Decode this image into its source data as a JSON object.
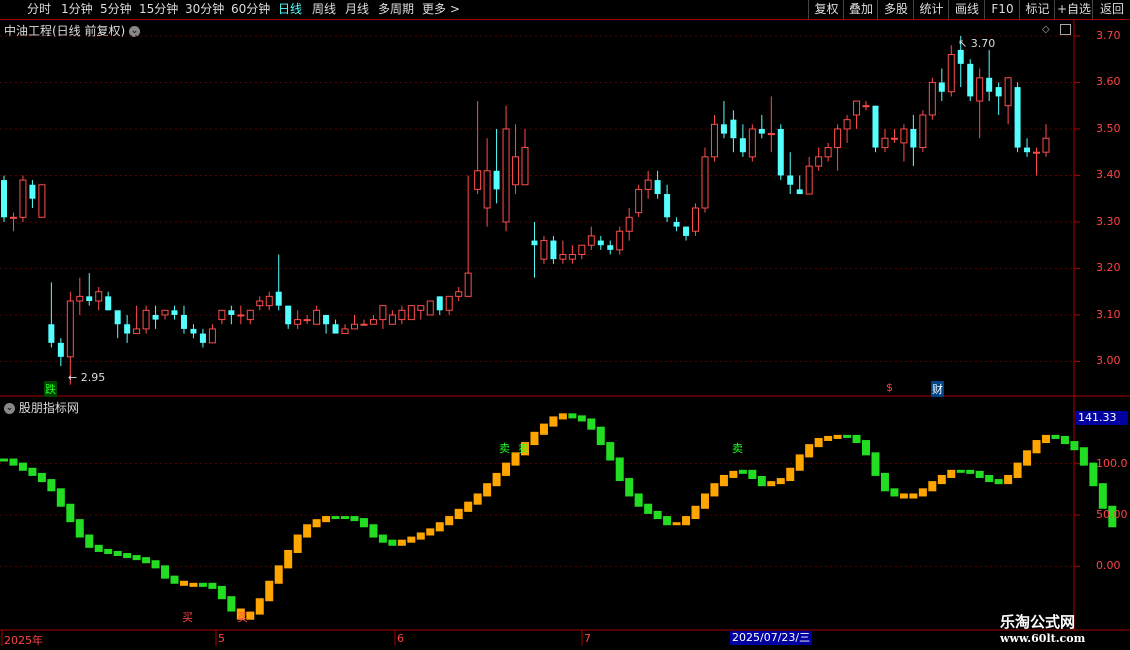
{
  "toolbar": {
    "periods": [
      "分时",
      "1分钟",
      "5分钟",
      "15分钟",
      "30分钟",
      "60分钟",
      "日线",
      "周线",
      "月线",
      "多周期",
      "更多 >"
    ],
    "active": "日线",
    "right_buttons": [
      "复权",
      "叠加",
      "多股",
      "统计",
      "画线",
      "F10",
      "标记",
      "+自选",
      "返回"
    ]
  },
  "chart_title": "中油工程(日线 前复权)",
  "indicator_title": "股朋指标网",
  "price_axis": [
    "3.70",
    "3.60",
    "3.50",
    "3.40",
    "3.30",
    "3.20",
    "3.10",
    "3.00"
  ],
  "indicator_axis": [
    "100.0",
    "50.00",
    "0.00"
  ],
  "indicator_value": "141.33",
  "x_labels": [
    "2025年",
    "5",
    "6",
    "7"
  ],
  "date_cursor": "2025/07/23/三",
  "annotations": {
    "high": "3.70",
    "low": "2.95",
    "low_marker": "跌",
    "cai_marker": "财",
    "dollar_marker": "$",
    "buy": "买",
    "sell": "卖"
  },
  "watermark": {
    "line1": "乐淘公式网",
    "line2": "www.60lt.com"
  },
  "colors": {
    "up": "#ff4d4d",
    "down": "#54ffff",
    "ind_up": "#ffa500",
    "ind_down": "#22dd22",
    "grid": "#a00000"
  },
  "chart_data": {
    "type": "candlestick",
    "ylim": [
      2.93,
      3.73
    ],
    "candles": [
      [
        3.39,
        3.31,
        3.4,
        3.3
      ],
      [
        3.31,
        3.31,
        3.32,
        3.28
      ],
      [
        3.31,
        3.39,
        3.4,
        3.3
      ],
      [
        3.38,
        3.35,
        3.39,
        3.33
      ],
      [
        3.31,
        3.38,
        3.38,
        3.31
      ],
      [
        3.08,
        3.04,
        3.17,
        3.03
      ],
      [
        3.04,
        3.01,
        3.05,
        2.99
      ],
      [
        3.01,
        3.13,
        3.15,
        2.95
      ],
      [
        3.13,
        3.14,
        3.18,
        3.1
      ],
      [
        3.14,
        3.13,
        3.19,
        3.12
      ],
      [
        3.13,
        3.15,
        3.16,
        3.11
      ],
      [
        3.14,
        3.11,
        3.15,
        3.11
      ],
      [
        3.11,
        3.08,
        3.1,
        3.05
      ],
      [
        3.08,
        3.06,
        3.1,
        3.04
      ],
      [
        3.06,
        3.07,
        3.12,
        3.06
      ],
      [
        3.07,
        3.11,
        3.12,
        3.06
      ],
      [
        3.1,
        3.09,
        3.12,
        3.07
      ],
      [
        3.1,
        3.11,
        3.11,
        3.09
      ],
      [
        3.11,
        3.1,
        3.12,
        3.09
      ],
      [
        3.1,
        3.07,
        3.12,
        3.06
      ],
      [
        3.07,
        3.06,
        3.08,
        3.05
      ],
      [
        3.06,
        3.04,
        3.07,
        3.03
      ],
      [
        3.04,
        3.07,
        3.08,
        3.04
      ],
      [
        3.09,
        3.11,
        3.11,
        3.08
      ],
      [
        3.11,
        3.1,
        3.12,
        3.08
      ],
      [
        3.1,
        3.1,
        3.12,
        3.08
      ],
      [
        3.09,
        3.11,
        3.11,
        3.08
      ],
      [
        3.12,
        3.13,
        3.14,
        3.11
      ],
      [
        3.12,
        3.14,
        3.15,
        3.11
      ],
      [
        3.15,
        3.12,
        3.23,
        3.11
      ],
      [
        3.12,
        3.08,
        3.12,
        3.07
      ],
      [
        3.08,
        3.09,
        3.11,
        3.07
      ],
      [
        3.09,
        3.09,
        3.1,
        3.08
      ],
      [
        3.08,
        3.11,
        3.12,
        3.08
      ],
      [
        3.1,
        3.08,
        3.1,
        3.06
      ],
      [
        3.08,
        3.06,
        3.09,
        3.06
      ],
      [
        3.06,
        3.07,
        3.08,
        3.06
      ],
      [
        3.07,
        3.08,
        3.1,
        3.07
      ],
      [
        3.08,
        3.08,
        3.09,
        3.08
      ],
      [
        3.08,
        3.09,
        3.1,
        3.08
      ],
      [
        3.09,
        3.12,
        3.12,
        3.07
      ],
      [
        3.08,
        3.1,
        3.11,
        3.08
      ],
      [
        3.09,
        3.11,
        3.12,
        3.08
      ],
      [
        3.09,
        3.12,
        3.12,
        3.09
      ],
      [
        3.11,
        3.12,
        3.12,
        3.09
      ],
      [
        3.1,
        3.13,
        3.13,
        3.1
      ],
      [
        3.14,
        3.11,
        3.14,
        3.1
      ],
      [
        3.11,
        3.14,
        3.14,
        3.1
      ],
      [
        3.14,
        3.15,
        3.16,
        3.13
      ],
      [
        3.14,
        3.19,
        3.4,
        3.18
      ],
      [
        3.37,
        3.41,
        3.56,
        3.36
      ],
      [
        3.33,
        3.41,
        3.48,
        3.29
      ],
      [
        3.41,
        3.37,
        3.5,
        3.34
      ],
      [
        3.3,
        3.5,
        3.55,
        3.28
      ],
      [
        3.38,
        3.44,
        3.51,
        3.36
      ],
      [
        3.38,
        3.46,
        3.5,
        3.38
      ],
      [
        3.26,
        3.25,
        3.3,
        3.18
      ],
      [
        3.22,
        3.26,
        3.27,
        3.21
      ],
      [
        3.26,
        3.22,
        3.27,
        3.21
      ],
      [
        3.22,
        3.23,
        3.26,
        3.21
      ],
      [
        3.22,
        3.23,
        3.25,
        3.21
      ],
      [
        3.23,
        3.25,
        3.25,
        3.22
      ],
      [
        3.25,
        3.27,
        3.29,
        3.24
      ],
      [
        3.26,
        3.25,
        3.27,
        3.24
      ],
      [
        3.25,
        3.24,
        3.26,
        3.23
      ],
      [
        3.24,
        3.28,
        3.29,
        3.23
      ],
      [
        3.28,
        3.31,
        3.33,
        3.26
      ],
      [
        3.32,
        3.37,
        3.38,
        3.31
      ],
      [
        3.37,
        3.39,
        3.41,
        3.35
      ],
      [
        3.39,
        3.36,
        3.41,
        3.35
      ],
      [
        3.36,
        3.31,
        3.38,
        3.3
      ],
      [
        3.3,
        3.29,
        3.31,
        3.28
      ],
      [
        3.29,
        3.27,
        3.29,
        3.26
      ],
      [
        3.28,
        3.33,
        3.34,
        3.27
      ],
      [
        3.33,
        3.44,
        3.46,
        3.32
      ],
      [
        3.44,
        3.51,
        3.53,
        3.43
      ],
      [
        3.51,
        3.49,
        3.56,
        3.48
      ],
      [
        3.52,
        3.48,
        3.54,
        3.45
      ],
      [
        3.48,
        3.45,
        3.51,
        3.44
      ],
      [
        3.44,
        3.5,
        3.51,
        3.43
      ],
      [
        3.5,
        3.49,
        3.53,
        3.48
      ],
      [
        3.49,
        3.49,
        3.57,
        3.45
      ],
      [
        3.5,
        3.4,
        3.51,
        3.39
      ],
      [
        3.4,
        3.38,
        3.45,
        3.36
      ],
      [
        3.37,
        3.36,
        3.4,
        3.36
      ],
      [
        3.36,
        3.42,
        3.44,
        3.36
      ],
      [
        3.42,
        3.44,
        3.46,
        3.41
      ],
      [
        3.44,
        3.46,
        3.47,
        3.43
      ],
      [
        3.46,
        3.5,
        3.51,
        3.41
      ],
      [
        3.5,
        3.52,
        3.53,
        3.47
      ],
      [
        3.53,
        3.56,
        3.56,
        3.5
      ],
      [
        3.55,
        3.55,
        3.56,
        3.54
      ],
      [
        3.55,
        3.46,
        3.55,
        3.45
      ],
      [
        3.46,
        3.48,
        3.5,
        3.45
      ],
      [
        3.48,
        3.48,
        3.5,
        3.47
      ],
      [
        3.47,
        3.5,
        3.51,
        3.43
      ],
      [
        3.5,
        3.46,
        3.53,
        3.42
      ],
      [
        3.46,
        3.53,
        3.54,
        3.45
      ],
      [
        3.53,
        3.6,
        3.61,
        3.52
      ],
      [
        3.6,
        3.58,
        3.63,
        3.56
      ],
      [
        3.58,
        3.66,
        3.68,
        3.57
      ],
      [
        3.67,
        3.64,
        3.7,
        3.59
      ],
      [
        3.64,
        3.57,
        3.65,
        3.56
      ],
      [
        3.56,
        3.61,
        3.63,
        3.48
      ],
      [
        3.61,
        3.58,
        3.67,
        3.56
      ],
      [
        3.59,
        3.57,
        3.6,
        3.53
      ],
      [
        3.55,
        3.61,
        3.61,
        3.51
      ],
      [
        3.59,
        3.46,
        3.6,
        3.45
      ],
      [
        3.46,
        3.45,
        3.48,
        3.44
      ],
      [
        3.45,
        3.45,
        3.46,
        3.4
      ],
      [
        3.45,
        3.48,
        3.51,
        3.44
      ]
    ],
    "indicator": [
      [
        104,
        0
      ],
      [
        100,
        0
      ],
      [
        95,
        0
      ],
      [
        90,
        0
      ],
      [
        84,
        0
      ],
      [
        75,
        0
      ],
      [
        60,
        0
      ],
      [
        45,
        0
      ],
      [
        30,
        0
      ],
      [
        20,
        0
      ],
      [
        16,
        0
      ],
      [
        14,
        0
      ],
      [
        12,
        0
      ],
      [
        10,
        0
      ],
      [
        8,
        0
      ],
      [
        5,
        0
      ],
      [
        0,
        0
      ],
      [
        -10,
        0
      ],
      [
        -15,
        0
      ],
      [
        -17,
        1
      ],
      [
        -18,
        1
      ],
      [
        -17,
        0
      ],
      [
        -20,
        0
      ],
      [
        -30,
        0
      ],
      [
        -42,
        0
      ],
      [
        -50,
        1
      ],
      [
        -45,
        1
      ],
      [
        -32,
        1
      ],
      [
        -15,
        1
      ],
      [
        0,
        1
      ],
      [
        15,
        1
      ],
      [
        30,
        1
      ],
      [
        40,
        1
      ],
      [
        45,
        1
      ],
      [
        48,
        1
      ],
      [
        48,
        0
      ],
      [
        48,
        0
      ],
      [
        46,
        0
      ],
      [
        40,
        0
      ],
      [
        30,
        0
      ],
      [
        25,
        0
      ],
      [
        22,
        0
      ],
      [
        25,
        1
      ],
      [
        28,
        1
      ],
      [
        32,
        1
      ],
      [
        36,
        1
      ],
      [
        42,
        1
      ],
      [
        48,
        1
      ],
      [
        55,
        1
      ],
      [
        62,
        1
      ],
      [
        70,
        1
      ],
      [
        80,
        1
      ],
      [
        90,
        1
      ],
      [
        100,
        1
      ],
      [
        110,
        1
      ],
      [
        120,
        1
      ],
      [
        130,
        1
      ],
      [
        138,
        1
      ],
      [
        145,
        1
      ],
      [
        148,
        1
      ],
      [
        146,
        0
      ],
      [
        143,
        0
      ],
      [
        135,
        0
      ],
      [
        120,
        0
      ],
      [
        105,
        0
      ],
      [
        85,
        0
      ],
      [
        70,
        0
      ],
      [
        60,
        0
      ],
      [
        53,
        0
      ],
      [
        48,
        0
      ],
      [
        42,
        0
      ],
      [
        42,
        1
      ],
      [
        48,
        1
      ],
      [
        58,
        1
      ],
      [
        70,
        1
      ],
      [
        80,
        1
      ],
      [
        88,
        1
      ],
      [
        92,
        1
      ],
      [
        93,
        0
      ],
      [
        87,
        0
      ],
      [
        80,
        0
      ],
      [
        82,
        1
      ],
      [
        85,
        1
      ],
      [
        95,
        1
      ],
      [
        108,
        1
      ],
      [
        118,
        1
      ],
      [
        124,
        1
      ],
      [
        126,
        1
      ],
      [
        127,
        1
      ],
      [
        127,
        0
      ],
      [
        122,
        0
      ],
      [
        110,
        0
      ],
      [
        90,
        0
      ],
      [
        75,
        0
      ],
      [
        70,
        0
      ],
      [
        68,
        1
      ],
      [
        70,
        1
      ],
      [
        75,
        1
      ],
      [
        82,
        1
      ],
      [
        88,
        1
      ],
      [
        93,
        1
      ],
      [
        93,
        0
      ],
      [
        92,
        0
      ],
      [
        88,
        0
      ],
      [
        84,
        0
      ],
      [
        82,
        0
      ],
      [
        88,
        1
      ],
      [
        100,
        1
      ],
      [
        112,
        1
      ],
      [
        122,
        1
      ],
      [
        127,
        1
      ],
      [
        126,
        0
      ],
      [
        121,
        0
      ],
      [
        115,
        0
      ],
      [
        100,
        0
      ],
      [
        80,
        0
      ],
      [
        58,
        0
      ],
      [
        40,
        0
      ]
    ],
    "indicator_ylim": [
      -60,
      160
    ]
  }
}
